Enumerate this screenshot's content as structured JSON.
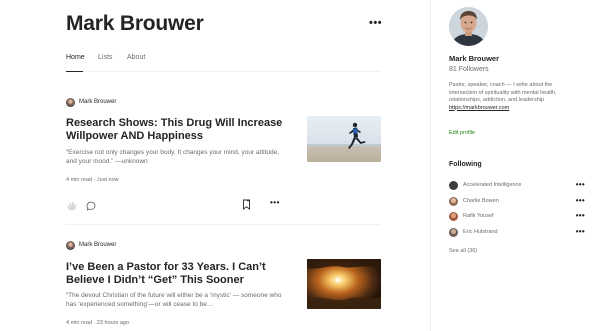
{
  "author": {
    "name": "Mark Brouwer"
  },
  "tabs": [
    {
      "label": "Home",
      "active": true
    },
    {
      "label": "Lists",
      "active": false
    },
    {
      "label": "About",
      "active": false
    }
  ],
  "posts": [
    {
      "author": "Mark Brouwer",
      "title": "Research Shows: This Drug Will Increase Willpower AND Happiness",
      "subtitle": "“Exercise not only changes your body. It changes your mind, your attitude, and your mood.” —unknown",
      "read_time": "4 min read",
      "time": "Just now"
    },
    {
      "author": "Mark Brouwer",
      "title": "I’ve Been a Pastor for 33 Years. I Can’t Believe I Didn’t “Get” This Sooner",
      "subtitle": "“The devout Christian of the future will either be a ‘mystic’ — someone who has ‘experienced something’—or will cease to be…",
      "read_time": "4 min read",
      "time": "23 hours ago"
    }
  ],
  "profile": {
    "name": "Mark Brouwer",
    "followers": "81 Followers",
    "bio": "Pastor, speaker, coach — I write about the intersection of spirituality with mental health, relationships, addiction, and leadership",
    "link": "https://markbrouwer.com",
    "edit_label": "Edit profile"
  },
  "following": {
    "heading": "Following",
    "items": [
      {
        "name": "Accelerated Intelligence",
        "color": "#3d3d3d"
      },
      {
        "name": "Charlie Bowen",
        "color": "#8c6a55"
      },
      {
        "name": "Rafik Yousef",
        "color": "#a15a3c"
      },
      {
        "name": "Eric Hulstrand",
        "color": "#6f5d52"
      }
    ],
    "see_all": "See all (36)"
  },
  "icons": {
    "more": "more-horizontal-icon",
    "clap": "clap-icon",
    "comment": "comment-icon",
    "bookmark": "bookmark-icon"
  },
  "colors": {
    "accent_green": "#1a8917",
    "text": "#242424",
    "muted": "#6b6b6b"
  }
}
